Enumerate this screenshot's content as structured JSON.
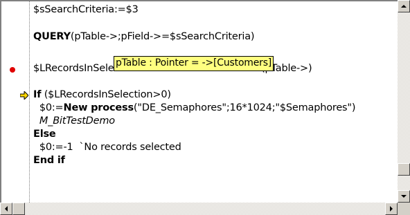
{
  "editor": {
    "lines": [
      {
        "text": "$sSearchCriteria:=$3"
      },
      {
        "kw": "QUERY",
        "rest": "(pTable->;pField->=$sSearchCriteria)"
      },
      {
        "pre": "$LRecordsInSelection:=",
        "kw": "Records in selection",
        "rest": "(pTable->)"
      },
      {
        "kw": "If",
        "rest": " ($LRecordsInSelection>0)"
      },
      {
        "pre": "  $0:=",
        "kw": "New process",
        "rest": "(\"DE_Semaphores\";16*1024;\"$Semaphores\")"
      },
      {
        "method": "M_BitTestDemo"
      },
      {
        "kw": "Else"
      },
      {
        "text": "  $0:=-1  `No records selected"
      },
      {
        "kw": "End if"
      }
    ],
    "tooltip": "pTable : Pointer = ->[Customers]",
    "breakpoint_color": "#e00000",
    "current_line_arrow_color": "#ffd800"
  },
  "icons": {
    "breakpoint": "breakpoint-dot-icon",
    "current_line": "current-line-arrow-icon",
    "scroll_up": "scroll-up-arrow-icon",
    "scroll_down": "scroll-down-arrow-icon",
    "scroll_left": "scroll-left-arrow-icon",
    "scroll_right": "scroll-right-arrow-icon"
  }
}
